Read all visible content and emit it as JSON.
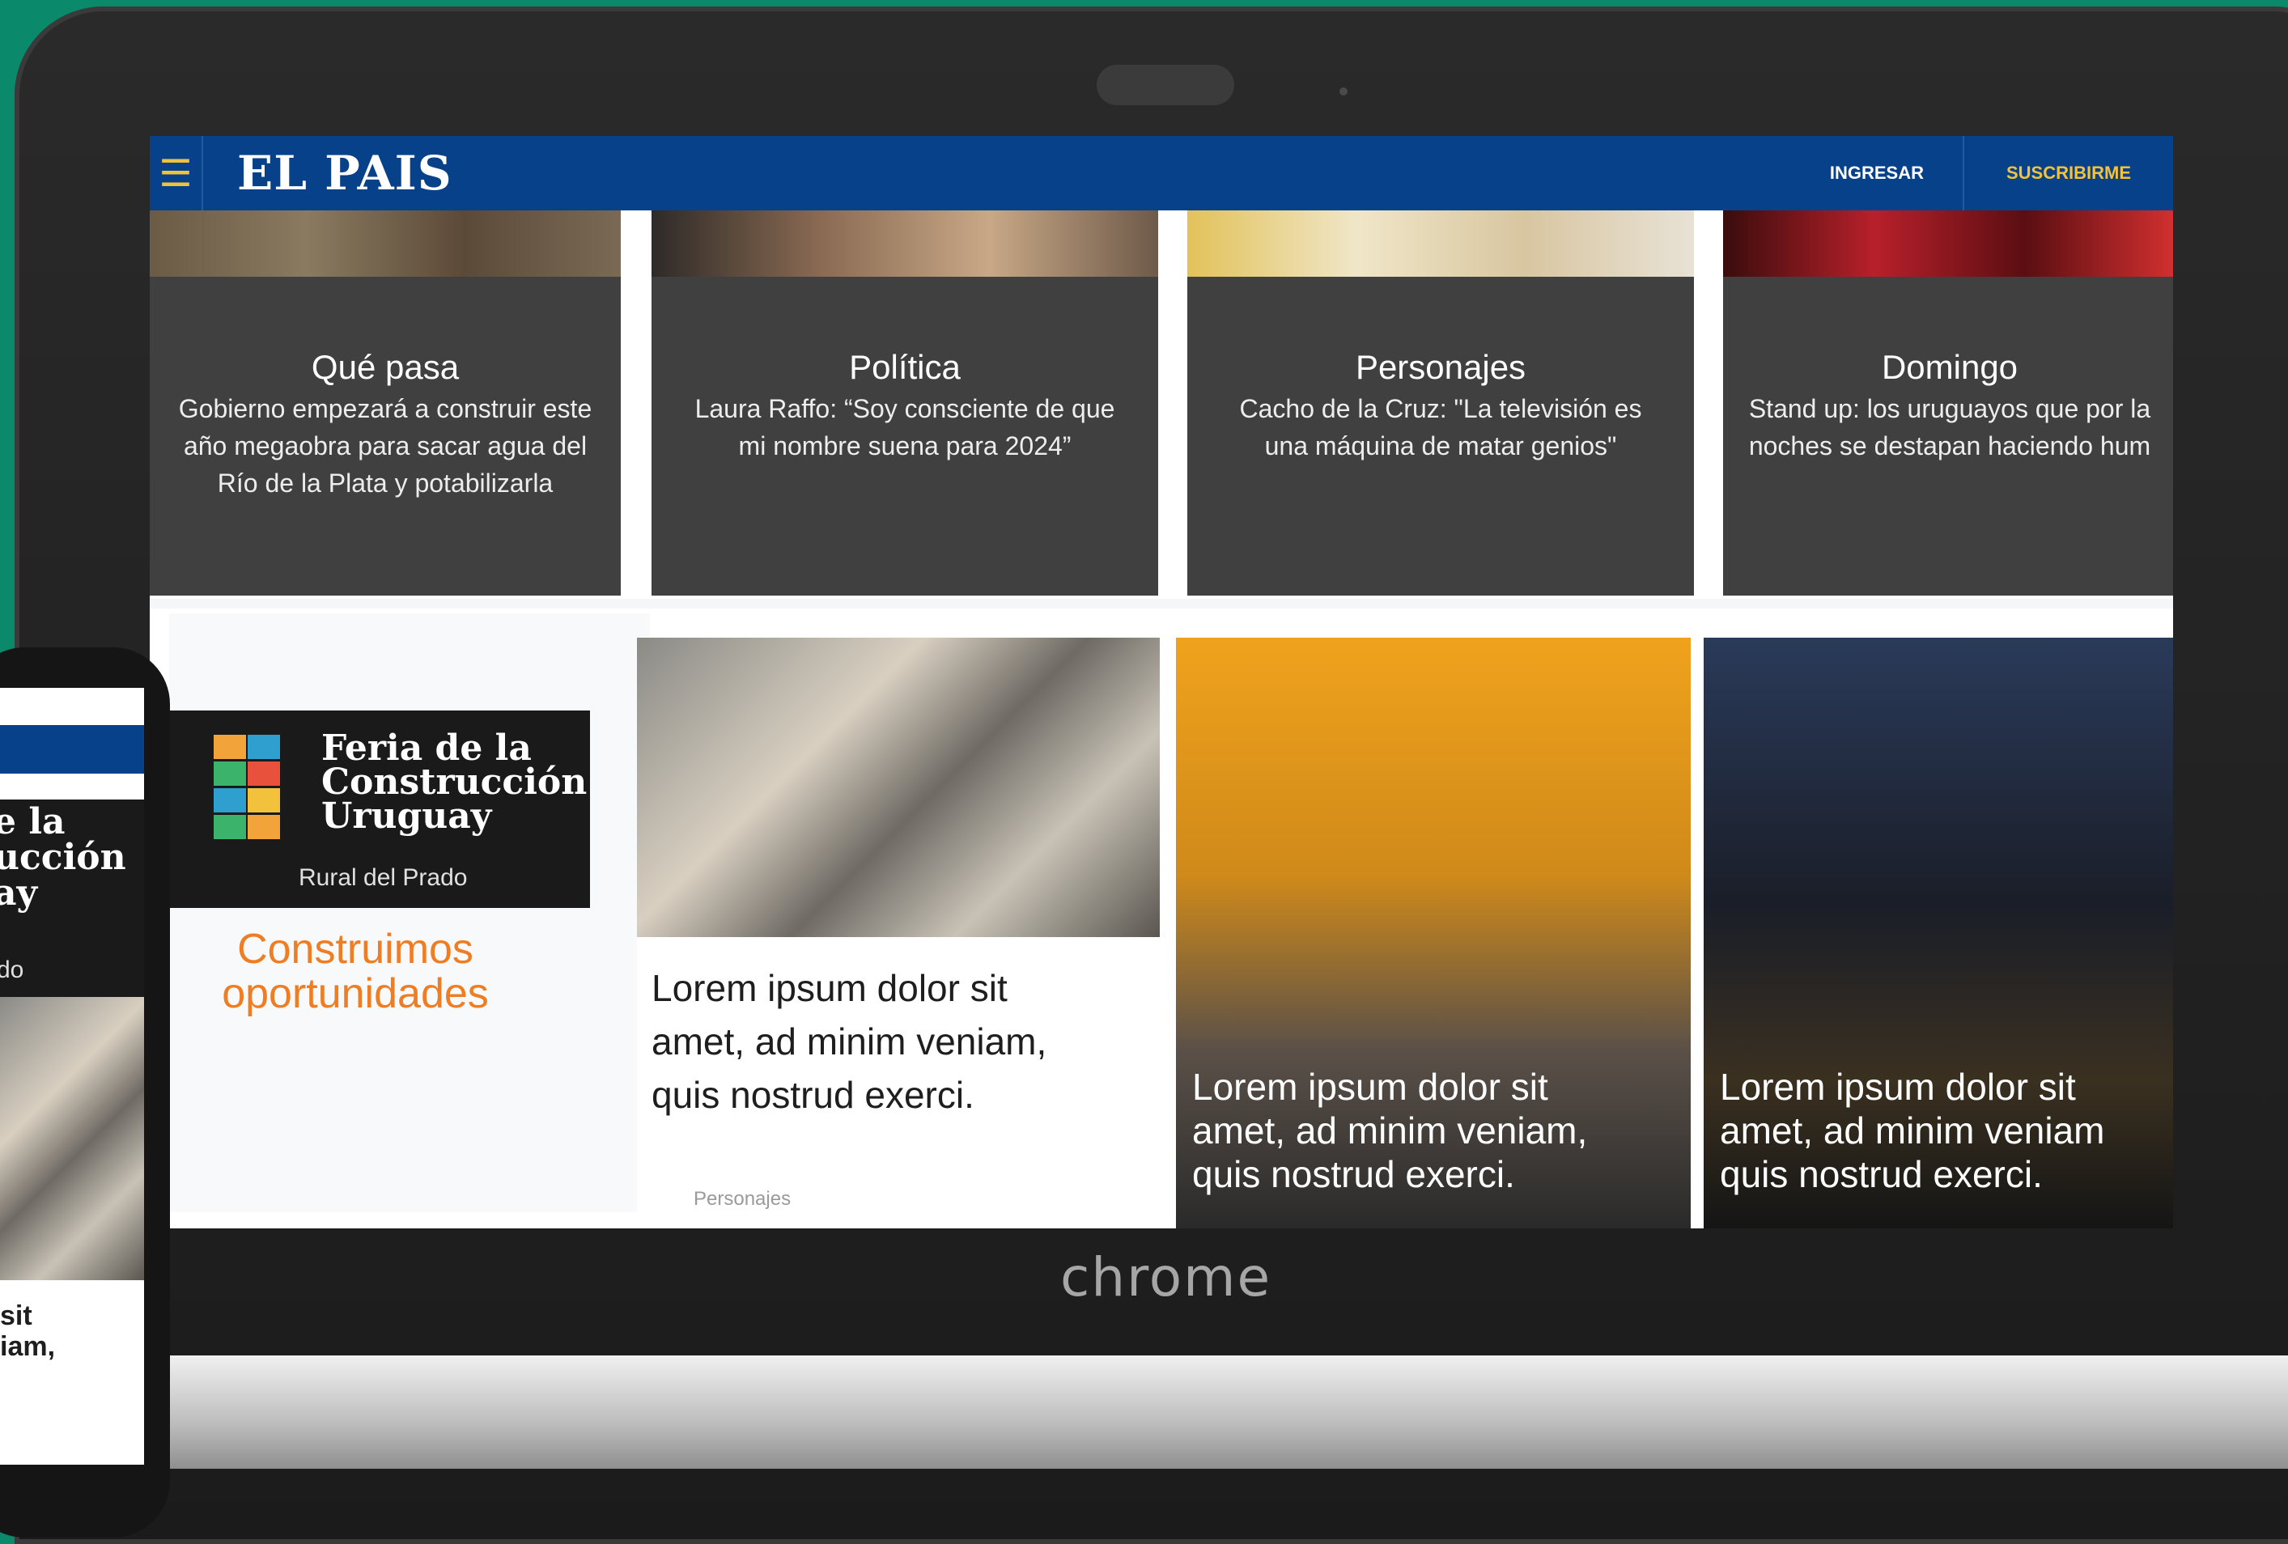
{
  "header": {
    "logo": "EL PAIS",
    "menu_icon": "hamburger-icon",
    "login_label": "INGRESAR",
    "subscribe_label": "SUSCRIBIRME",
    "bg_color": "#07418a",
    "accent_color": "#f2c23c"
  },
  "cards": [
    {
      "title": "Qué pasa",
      "text": "Gobierno empezará a construir este\naño megaobra para sacar agua del\nRío de la Plata y potabilizarla"
    },
    {
      "title": "Política",
      "text": "Laura Raffo: “Soy consciente de que\nmi nombre suena para 2024”"
    },
    {
      "title": "Personajes",
      "text": "Cacho de la Cruz: \"La televisión es\nuna máquina de matar genios\""
    },
    {
      "title": "Domingo",
      "text": "Stand up: los uruguayos que por la\nnoches se destapan haciendo hum"
    }
  ],
  "promo": {
    "feria_title": "Feria de la\nConstrucción\nUruguay",
    "feria_subtitle": "Rural del Prado",
    "tagline": "Construimos\noportunidades",
    "tagline_color": "#ef7d23"
  },
  "articles": [
    {
      "headline": "Lorem ipsum dolor sit\namet, ad minim veniam,\nquis nostrud exerci.",
      "tag": "Personajes"
    },
    {
      "headline": "Lorem ipsum dolor sit\namet, ad minim veniam,\nquis nostrud exerci."
    },
    {
      "headline": "Lorem ipsum dolor sit\namet, ad minim veniam\nquis nostrud exerci."
    }
  ],
  "device": {
    "brand": "chrome"
  },
  "phone": {
    "feria_text": "e la\nucción\nay",
    "feria_sub": "do",
    "text": "sit\niam,"
  }
}
